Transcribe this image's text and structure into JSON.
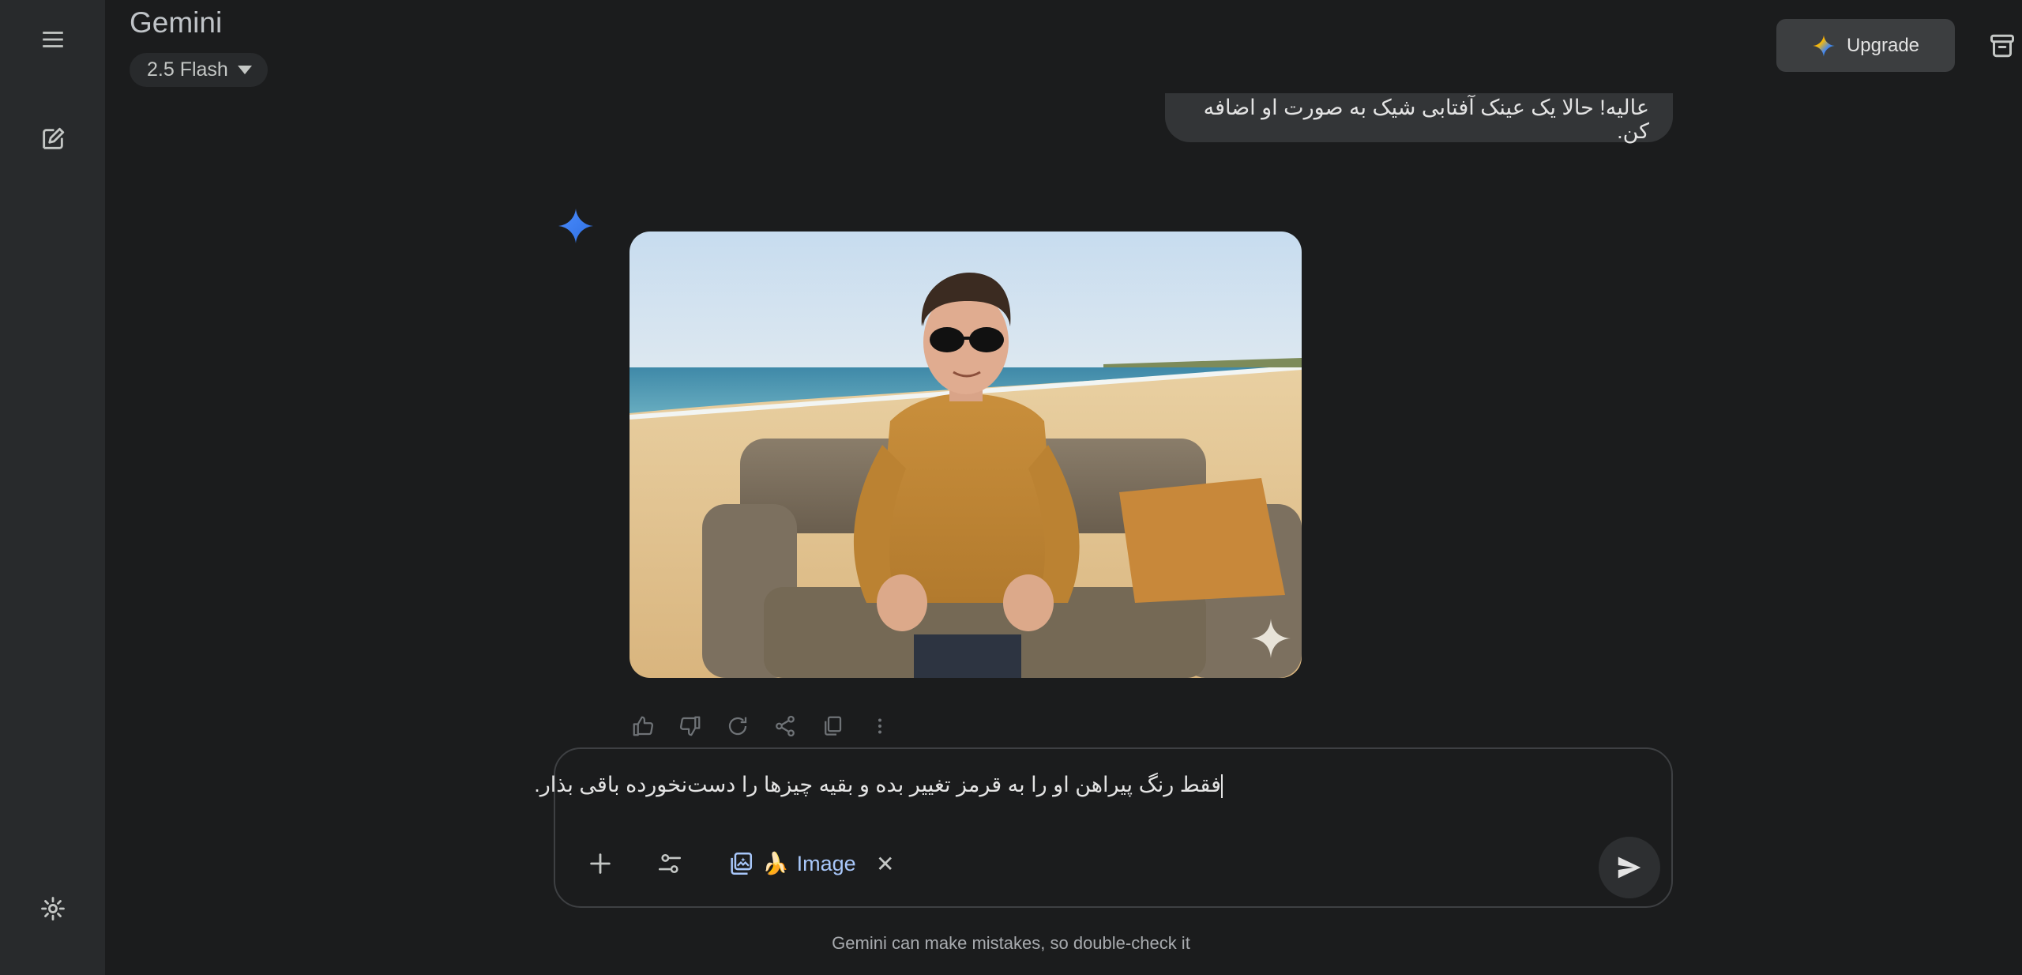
{
  "app": {
    "title": "Gemini"
  },
  "model": {
    "selected": "2.5 Flash"
  },
  "header": {
    "upgrade_label": "Upgrade"
  },
  "conversation": {
    "user_message": "عالیه! حالا یک عینک آفتابی شیک به صورت او اضافه کن."
  },
  "composer": {
    "input_text": "فقط رنگ پیراهن او را به قرمز تغییر بده و بقیه چیزها را دست‌نخورده باقی بذار.",
    "chip_label": "Image",
    "chip_emoji": "🍌"
  },
  "footer": {
    "disclaimer": "Gemini can make mistakes, so double-check it"
  },
  "icons": {
    "sidebar": [
      "menu-icon",
      "new-chat-icon",
      "settings-icon"
    ],
    "response_actions": [
      "thumbs-up-icon",
      "thumbs-down-icon",
      "regenerate-icon",
      "share-icon",
      "copy-icon",
      "more-vert-icon"
    ],
    "composer": [
      "add-icon",
      "tools-icon",
      "image-gen-icon",
      "close-icon",
      "send-icon"
    ]
  },
  "colors": {
    "background": "#1b1c1d",
    "sidebar": "#282a2c",
    "accent_blue": "#4285f4",
    "chip_text": "#a8c7fa"
  }
}
